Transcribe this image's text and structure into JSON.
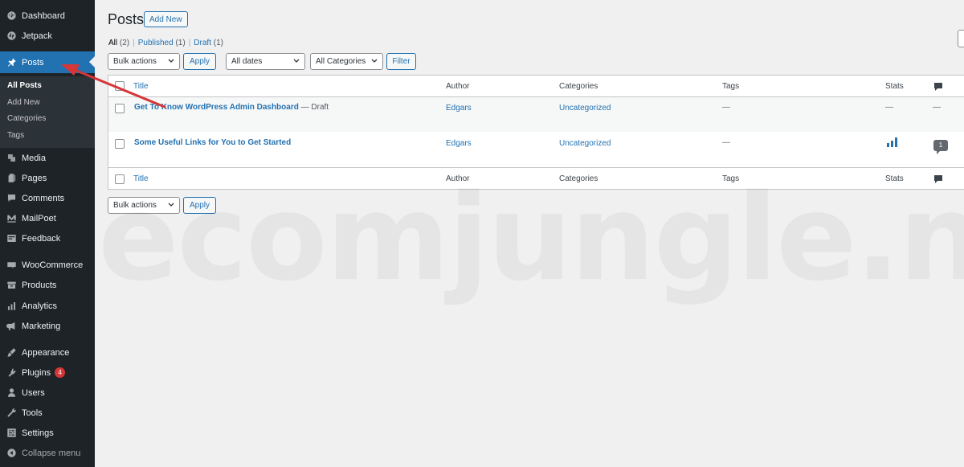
{
  "sidebar": {
    "items": [
      {
        "label": "Dashboard",
        "icon": "dashboard-icon"
      },
      {
        "label": "Jetpack",
        "icon": "jetpack-icon"
      },
      {
        "label": "Posts",
        "icon": "pin-icon"
      },
      {
        "label": "Media",
        "icon": "media-icon"
      },
      {
        "label": "Pages",
        "icon": "pages-icon"
      },
      {
        "label": "Comments",
        "icon": "comments-icon"
      },
      {
        "label": "MailPoet",
        "icon": "mailpoet-icon"
      },
      {
        "label": "Feedback",
        "icon": "feedback-icon"
      },
      {
        "label": "WooCommerce",
        "icon": "woocommerce-icon"
      },
      {
        "label": "Products",
        "icon": "products-icon"
      },
      {
        "label": "Analytics",
        "icon": "analytics-icon"
      },
      {
        "label": "Marketing",
        "icon": "megaphone-icon"
      },
      {
        "label": "Appearance",
        "icon": "brush-icon"
      },
      {
        "label": "Plugins",
        "icon": "plugins-icon",
        "badge": "4"
      },
      {
        "label": "Users",
        "icon": "users-icon"
      },
      {
        "label": "Tools",
        "icon": "wrench-icon"
      },
      {
        "label": "Settings",
        "icon": "settings-icon"
      },
      {
        "label": "Collapse menu",
        "icon": "collapse-icon"
      }
    ],
    "submenu": [
      "All Posts",
      "Add New",
      "Categories",
      "Tags"
    ]
  },
  "header": {
    "title": "Posts",
    "add_new_label": "Add New"
  },
  "filters": {
    "all_label": "All",
    "all_count": "(2)",
    "published_label": "Published",
    "published_count": "(1)",
    "draft_label": "Draft",
    "draft_count": "(1)",
    "separator": "|",
    "bulk_actions": "Bulk actions",
    "apply_label": "Apply",
    "dates": "All dates",
    "categories": "All Categories",
    "filter_label": "Filter"
  },
  "table": {
    "columns": {
      "title": "Title",
      "author": "Author",
      "categories": "Categories",
      "tags": "Tags",
      "stats": "Stats"
    },
    "rows": [
      {
        "title": "Get To Know WordPress Admin Dashboard",
        "state": " — Draft",
        "author": "Edgars",
        "category": "Uncategorized",
        "tags": "—",
        "stats": "—",
        "comments": "—"
      },
      {
        "title": "Some Useful Links for You to Get Started",
        "state": "",
        "author": "Edgars",
        "category": "Uncategorized",
        "tags": "—",
        "stats": "",
        "comments": "1"
      }
    ]
  },
  "watermark": "ecomjungle.net",
  "colors": {
    "sidebar_bg": "#1d2327",
    "accent": "#2271b1",
    "annotation_arrow": "#d63638",
    "badge": "#d63638"
  }
}
